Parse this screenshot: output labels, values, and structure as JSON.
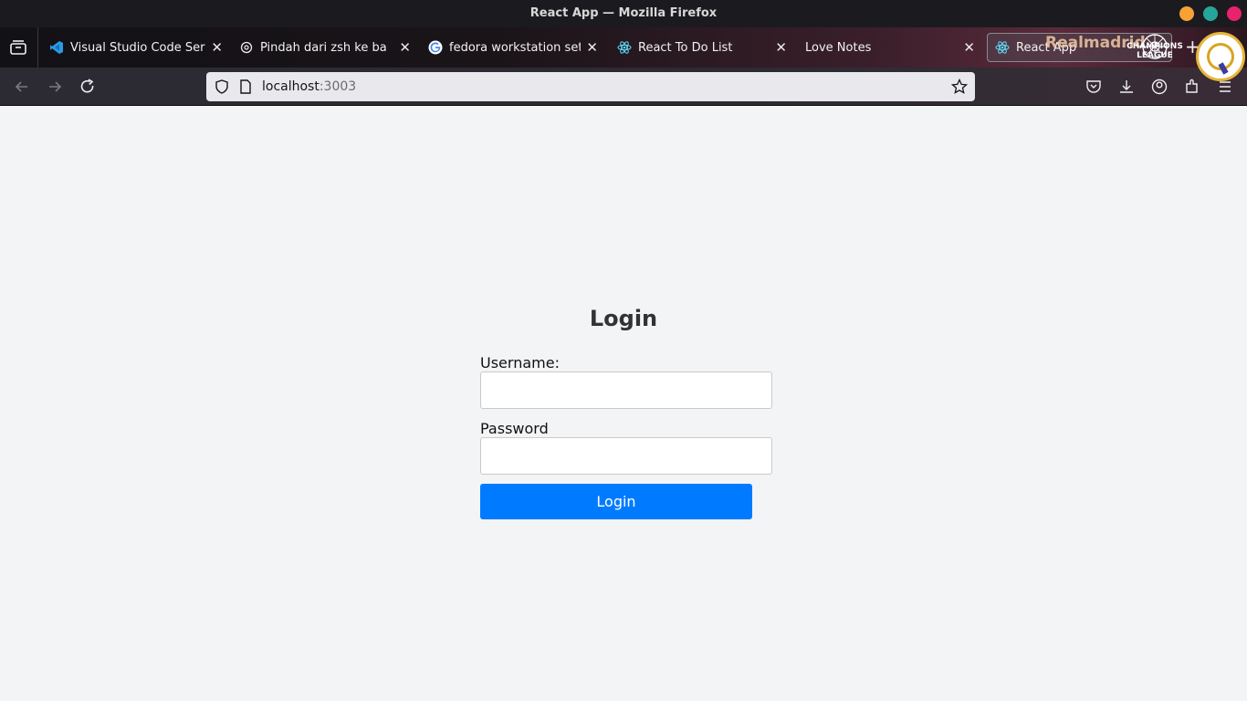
{
  "window": {
    "title": "React App — Mozilla Firefox"
  },
  "tabs": [
    {
      "label": "Visual Studio Code Server",
      "icon": "vscode-icon"
    },
    {
      "label": "Pindah dari zsh ke bash",
      "icon": "chatgpt-icon"
    },
    {
      "label": "fedora workstation setup",
      "icon": "google-icon"
    },
    {
      "label": "React To Do List",
      "icon": "react-icon"
    },
    {
      "label": "Love Notes",
      "icon": ""
    },
    {
      "label": "React App",
      "icon": "react-icon",
      "active": true
    }
  ],
  "theme": {
    "brand_text": "Realmadrid",
    "badge_text": "CHAMPIONS LEAGUE"
  },
  "navbar": {
    "url_host": "localhost",
    "url_port": ":3003"
  },
  "login": {
    "title": "Login",
    "username_label": "Username:",
    "username_value": "",
    "password_label": "Password",
    "password_value": "",
    "button_label": "Login"
  },
  "colors": {
    "primary_button": "#007bff",
    "page_background": "#f3f4f6"
  }
}
